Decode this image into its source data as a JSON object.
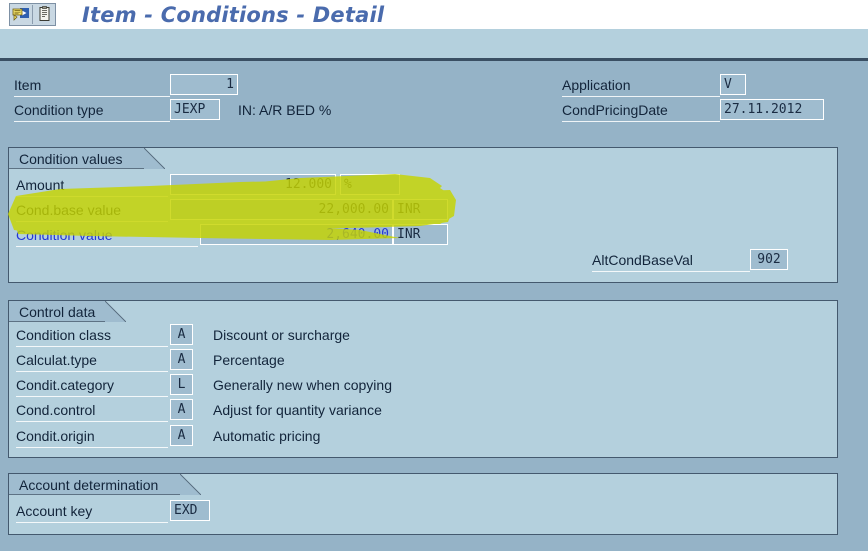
{
  "window": {
    "title": "Item - Conditions - Detail",
    "icons": [
      "check-with-arrow-icon",
      "document-icon"
    ]
  },
  "header_form": {
    "left": [
      {
        "label": "Item",
        "value": "1",
        "align": "right",
        "name": "item"
      },
      {
        "label": "Condition type",
        "value": "JEXP",
        "align": "left",
        "name": "condition-type",
        "description": "IN: A/R BED %"
      }
    ],
    "right": [
      {
        "label": "Application",
        "value": "V",
        "align": "left",
        "name": "application"
      },
      {
        "label": "CondPricingDate",
        "value": "27.11.2012",
        "align": "left",
        "name": "cond-pricing-date"
      }
    ]
  },
  "condition_values": {
    "title": "Condition values",
    "rows": [
      {
        "label": "Amount",
        "value": "12.000",
        "unit": "%",
        "name": "amount",
        "label_color": "dark"
      },
      {
        "label": "Cond.base value",
        "value": "22,000.00",
        "unit": "INR",
        "name": "cond-base-value",
        "label_color": "dark"
      },
      {
        "label": "Condition value",
        "value": "2,640.00",
        "unit": "INR",
        "name": "condition-value",
        "label_color": "blue"
      }
    ],
    "alt_cond_base_val": {
      "label": "AltCondBaseVal",
      "value": "902",
      "name": "alt-cond-base-val"
    }
  },
  "control_data": {
    "title": "Control data",
    "rows": [
      {
        "label": "Condition class",
        "value": "A",
        "description": "Discount or surcharge",
        "name": "condition-class"
      },
      {
        "label": "Calculat.type",
        "value": "A",
        "description": "Percentage",
        "name": "calculat-type"
      },
      {
        "label": "Condit.category",
        "value": "L",
        "description": "Generally new when copying",
        "name": "condit-category"
      },
      {
        "label": "Cond.control",
        "value": "A",
        "description": "Adjust for quantity variance",
        "name": "cond-control"
      },
      {
        "label": "Condit.origin",
        "value": "A",
        "description": "Automatic pricing",
        "name": "condit-origin"
      }
    ]
  },
  "account_determination": {
    "title": "Account determination",
    "rows": [
      {
        "label": "Account key",
        "value": "EXD",
        "name": "account-key"
      }
    ]
  },
  "annotation": {
    "type": "highlighter-marker",
    "color": "#c8d400",
    "target": "Cond.base value row"
  },
  "colors": {
    "page_background": "#95b3c7",
    "group_background": "#b4d0dd",
    "field_background": "#9fbccf",
    "title_text": "#4a6bad",
    "link_text": "#2436d8",
    "highlight": "#c8d400"
  }
}
